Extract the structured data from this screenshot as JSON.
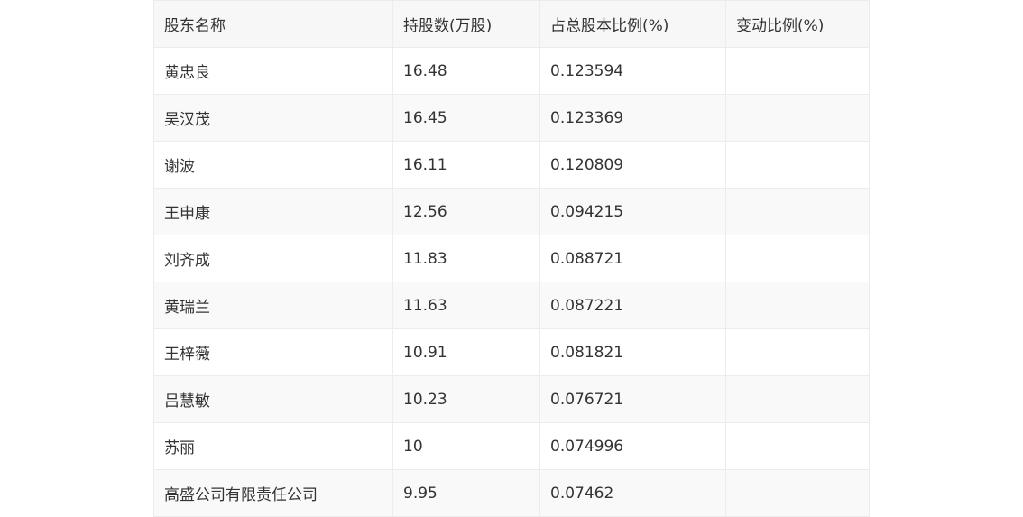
{
  "table": {
    "headers": [
      "股东名称",
      "持股数(万股)",
      "占总股本比例(%)",
      "变动比例(%)"
    ],
    "rows": [
      [
        "黄忠良",
        "16.48",
        "0.123594",
        ""
      ],
      [
        "吴汉茂",
        "16.45",
        "0.123369",
        ""
      ],
      [
        "谢波",
        "16.11",
        "0.120809",
        ""
      ],
      [
        "王申康",
        "12.56",
        "0.094215",
        ""
      ],
      [
        "刘齐成",
        "11.83",
        "0.088721",
        ""
      ],
      [
        "黄瑞兰",
        "11.63",
        "0.087221",
        ""
      ],
      [
        "王梓薇",
        "10.91",
        "0.081821",
        ""
      ],
      [
        "吕慧敏",
        "10.23",
        "0.076721",
        ""
      ],
      [
        "苏丽",
        "10",
        "0.074996",
        ""
      ],
      [
        "高盛公司有限责任公司",
        "9.95",
        "0.07462",
        ""
      ]
    ]
  }
}
